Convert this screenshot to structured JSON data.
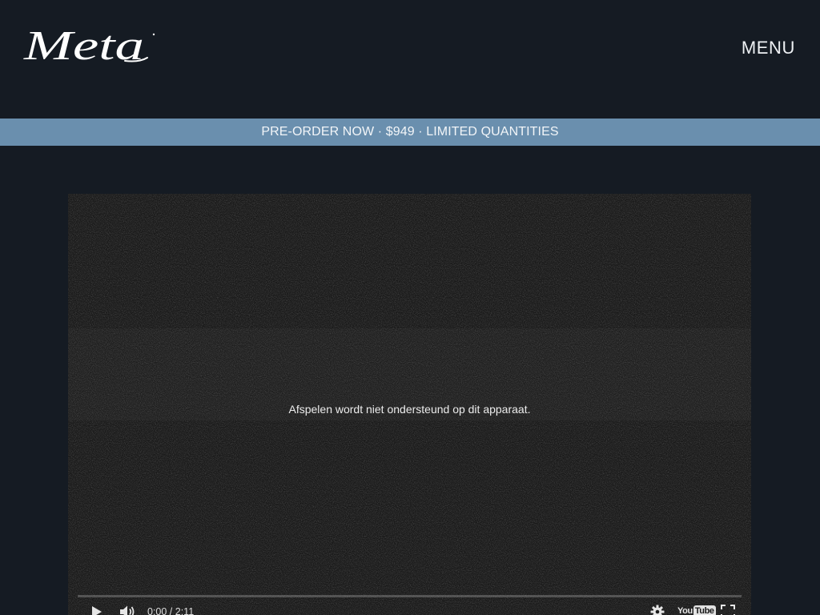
{
  "page": {
    "background": "#151b23"
  },
  "header": {
    "logo_text": "Meta",
    "menu_label": "MENU"
  },
  "banner": {
    "text": "PRE-ORDER NOW · $949 · LIMITED QUANTITIES",
    "background": "#6a8fae"
  },
  "video": {
    "message": "Afspelen wordt niet ondersteund op dit apparaat.",
    "progress": 0,
    "controls": {
      "play_icon": "play-icon",
      "volume_icon": "volume-icon",
      "time_display": "0:00 / 2:11",
      "settings_icon": "gear-icon",
      "fullscreen_icon": "fullscreen-icon"
    },
    "youtube_logo": {
      "part1": "You",
      "part2": "Tube"
    }
  }
}
